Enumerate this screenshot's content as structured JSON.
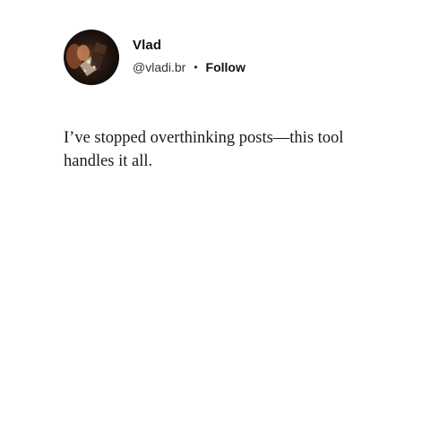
{
  "author": {
    "name": "Vlad",
    "handle": "@vladi.br",
    "separator": "•",
    "follow_label": "Follow",
    "avatar_icon": "profile-photo"
  },
  "post": {
    "text": "I’ve stopped overthinking posts—this tool handles it all."
  }
}
